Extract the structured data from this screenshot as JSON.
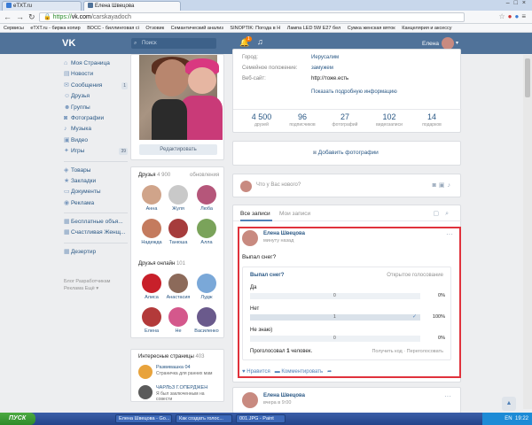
{
  "browser": {
    "tabs": [
      {
        "label": "eTXT.ru",
        "active": false
      },
      {
        "label": "Елена Швецова",
        "active": true
      }
    ],
    "address": {
      "scheme": "https://",
      "host": "vk.com",
      "path": "/carskayadoch"
    },
    "bookmarks": [
      "Сервисы",
      "eTXT.ru - биржа копир",
      "ВОСС - биллинговая сі",
      "Отзовик",
      "Семантический анализ",
      "SINOPTIK: Погода в Н",
      "Лампа LED 5W E27 бел",
      "Сумка женская вяток",
      "Канцелярия и аксессу"
    ]
  },
  "vk": {
    "logo": "VK",
    "search_placeholder": "Поиск",
    "notifications_badge": "1",
    "user_name": "Елена"
  },
  "left_menu": {
    "main": [
      {
        "label": "Моя Страница",
        "icon": "home-icon"
      },
      {
        "label": "Новости",
        "icon": "news-icon"
      },
      {
        "label": "Сообщения",
        "icon": "message-icon",
        "count": "1"
      },
      {
        "label": "Друзья",
        "icon": "friends-icon"
      },
      {
        "label": "Группы",
        "icon": "groups-icon"
      },
      {
        "label": "Фотографии",
        "icon": "camera-icon"
      },
      {
        "label": "Музыка",
        "icon": "music-icon"
      },
      {
        "label": "Видео",
        "icon": "video-icon"
      },
      {
        "label": "Игры",
        "icon": "games-icon",
        "count": "39"
      }
    ],
    "secondary": [
      {
        "label": "Товары",
        "icon": "shopping-icon"
      },
      {
        "label": "Закладки",
        "icon": "bookmark-icon"
      },
      {
        "label": "Документы",
        "icon": "document-icon"
      },
      {
        "label": "Реклама",
        "icon": "ads-icon"
      }
    ],
    "apps": [
      {
        "label": "Бесплатные объя...",
        "icon": "app-icon"
      },
      {
        "label": "Счастливая Женщ...",
        "icon": "app-icon"
      }
    ],
    "extra": [
      {
        "label": "Дезертир",
        "icon": "app-icon"
      }
    ],
    "footer": [
      "Блог",
      "Разработчикам",
      "Реклама",
      "Ещё ▾"
    ]
  },
  "profile": {
    "edit_button": "Редактировать",
    "friends": {
      "title": "Друзья",
      "count": "4 900",
      "updates": "обновления",
      "list": [
        "Анна",
        "Жуля",
        "Люба",
        "Надежда",
        "Танюша",
        "Алла"
      ]
    },
    "friends_online": {
      "title": "Друзья онлайн",
      "count": "101",
      "list": [
        "Алиса",
        "Анастасия",
        "Лудж",
        "Елена",
        "Не",
        "Василенко"
      ]
    },
    "interesting_pages": {
      "title": "Интересные страницы",
      "count": "403",
      "list": [
        {
          "title": "Развивашка 04",
          "desc": "Страничка для ранних мам"
        },
        {
          "title": "ЧАРЛЬЗ Г.ОПЕРДЖЕН",
          "desc": "Я был заключенным на совести"
        }
      ]
    }
  },
  "info": {
    "rows": [
      {
        "label": "Город:",
        "value": "Иерусалим"
      },
      {
        "label": "Семейное положение:",
        "value": "замужем"
      },
      {
        "label": "Веб-сайт:",
        "value": "http://тоже.есть"
      }
    ],
    "more_link": "Показать подробную информацию",
    "counters": [
      {
        "num": "4 500",
        "label": "друзей"
      },
      {
        "num": "96",
        "label": "подписчиков"
      },
      {
        "num": "27",
        "label": "фотографий"
      },
      {
        "num": "102",
        "label": "видеозаписи"
      },
      {
        "num": "14",
        "label": "подарков"
      }
    ]
  },
  "add_photos": "Добавить фотографии",
  "composer_placeholder": "Что у Вас нового?",
  "wall": {
    "tabs": [
      "Все записи",
      "Мои записи"
    ],
    "post": {
      "author": "Елена Швецова",
      "time": "минуту назад",
      "text": "Выпал снег?",
      "poll": {
        "question": "Выпал снег?",
        "type": "Открытое голосование",
        "options": [
          {
            "label": "Да",
            "count": "0",
            "percent": "0%",
            "share": 0,
            "checked": false
          },
          {
            "label": "Нет",
            "count": "1",
            "percent": "100%",
            "share": 100,
            "checked": true
          },
          {
            "label": "Не знаю)",
            "count": "0",
            "percent": "0%",
            "share": 0,
            "checked": false
          }
        ],
        "voted_prefix": "Проголосовал ",
        "voted_num": "1",
        "voted_suffix": " человек.",
        "links": "Получить код · Переголосовать"
      },
      "like": "Нравится",
      "comment": "Комментировать"
    },
    "post2": {
      "author": "Елена Швецова",
      "time": "вчера в 9:00"
    }
  },
  "taskbar": {
    "start": "ПУСК",
    "items": [
      "Елена Швецова - Go...",
      "Как создать голос...",
      "001.JPG - Paint"
    ],
    "lang": "EN",
    "clock": "19:22"
  }
}
